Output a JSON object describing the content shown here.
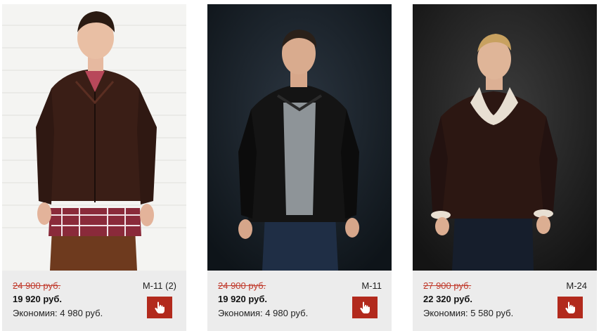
{
  "products": [
    {
      "image_alt": "Мужчина в коричневой кожаной куртке",
      "old_price": "24 900 руб.",
      "new_price": "19 920 руб.",
      "savings": "Экономия: 4 980 руб.",
      "sku": "M-11 (2)",
      "button_icon": "hand-pointer-icon"
    },
    {
      "image_alt": "Мужчина в черной кожаной куртке",
      "old_price": "24 900 руб.",
      "new_price": "19 920 руб.",
      "savings": "Экономия: 4 980 руб.",
      "sku": "M-11",
      "button_icon": "hand-pointer-icon"
    },
    {
      "image_alt": "Мужчина в коричневой кожаной куртке с меховым воротником",
      "old_price": "27 900 руб.",
      "new_price": "22 320 руб.",
      "savings": "Экономия: 5 580 руб.",
      "sku": "M-24",
      "button_icon": "hand-pointer-icon"
    }
  ],
  "colors": {
    "old_price": "#c0392b",
    "button": "#b22a1d",
    "info_bg": "#ececec"
  }
}
